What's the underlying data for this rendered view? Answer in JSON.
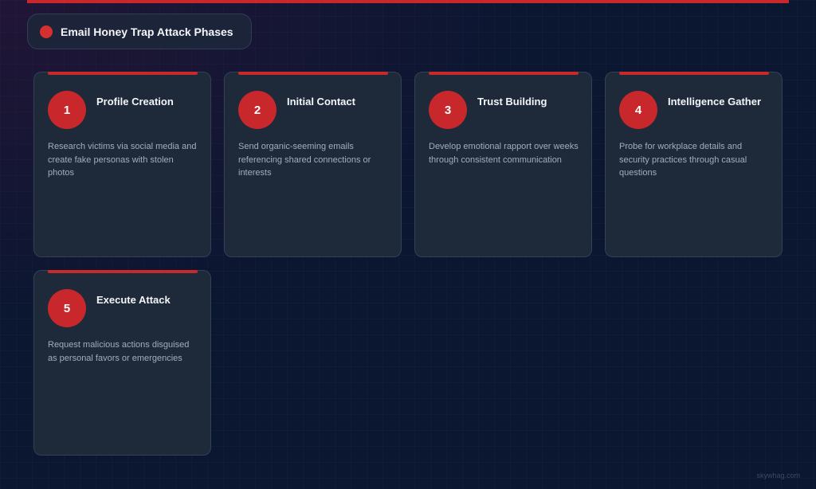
{
  "header": {
    "title": "Email Honey Trap Attack Phases"
  },
  "phases": [
    {
      "number": "1",
      "title": "Profile Creation",
      "description": "Research victims via social media and create fake personas with stolen photos"
    },
    {
      "number": "2",
      "title": "Initial Contact",
      "description": "Send organic-seeming emails referencing shared connections or interests"
    },
    {
      "number": "3",
      "title": "Trust Building",
      "description": "Develop emotional rapport over weeks through consistent communication"
    },
    {
      "number": "4",
      "title": "Intelligence Gather",
      "description": "Probe for workplace details and security practices through casual questions"
    },
    {
      "number": "5",
      "title": "Execute Attack",
      "description": "Request malicious actions disguised as personal favors or emergencies"
    }
  ],
  "watermark": "skywhag.com",
  "colors": {
    "background": "#0b1631",
    "accent": "#c8282b",
    "card": "#1e2939",
    "title_text": "#f3f5f8",
    "body_text": "#a3adbd"
  }
}
